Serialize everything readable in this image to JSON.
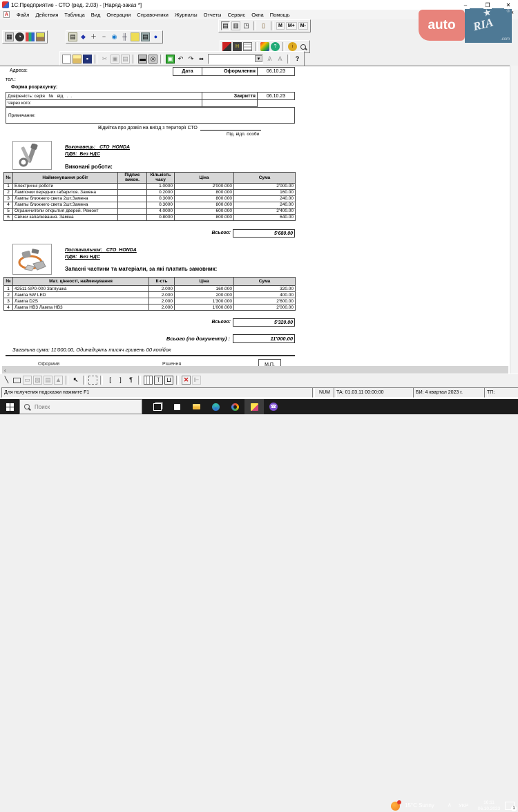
{
  "window": {
    "title": "1С:Предприятие - СТО (ред. 2.03) - [Наряд-заказ *]"
  },
  "icons": {
    "minimize": "–",
    "restore": "❐",
    "close": "✕",
    "mdi_close": "x",
    "menu_doc_letter": "А",
    "cut": "✂",
    "undo": "↶",
    "redo": "↷",
    "find": "∞",
    "help": "?",
    "dropdown": "▾",
    "scroll_up": "˄",
    "scroll_down": "˅",
    "scroll_left": "‹",
    "cursor": "↖",
    "paragraph": "¶",
    "bracket_open": "[",
    "bracket_close": "]",
    "line_tool": "╲",
    "red_cross": "✕",
    "chevron_up": "∧",
    "phone": "☎",
    "memory": [
      "М",
      "М+",
      "М-"
    ]
  },
  "menu": {
    "items": [
      "Файл",
      "Действия",
      "Таблица",
      "Вид",
      "Операции",
      "Справочники",
      "Журналы",
      "Отчеты",
      "Сервис",
      "Окна",
      "Помощь"
    ]
  },
  "watermark": {
    "auto": "auto",
    "ria": "RIA",
    "star": "★",
    "com": ".com",
    "reg": "®"
  },
  "doc": {
    "address_label": "Адреса:",
    "phone_label": "тел.:",
    "date_label": "Дата",
    "registration_label": "Оформлення",
    "registration_date": "06.10.23",
    "payment_form": "Форма розрахунку:",
    "proxy": "Довіреність: серія   №   від   .  .",
    "closing_label": "Закриття",
    "closing_date": "06.10.23",
    "via_label": "Через кого:",
    "note_label": "Примечание:",
    "exit_note": "Відмітка про дозвіл на виїзд з території СТО",
    "exit_officer": "Під. відп. особи",
    "executor": {
      "label": "Виконавець:   СТО  HONDA",
      "vat": "ПДВ:  Без НДС",
      "works_title": "Виконані роботи:"
    },
    "works_table": {
      "headers": [
        "№",
        "Найменування робіт",
        "Підпис викон.",
        "Кількість часу",
        "Ціна",
        "Сума"
      ],
      "rows": [
        [
          "1",
          "Електричні роботи",
          "",
          "1.0000",
          "2'000.000",
          "2'000.00"
        ],
        [
          "2",
          "Лампочки передних габаритов. Замена",
          "",
          "0.2000",
          "800.000",
          "160.00"
        ],
        [
          "3",
          "Лампы ближнего света 2шт.Замена",
          "",
          "0.3000",
          "800.000",
          "240.00"
        ],
        [
          "4",
          "Лампы ближнего света 2шт.Замена",
          "",
          "0.3000",
          "800.000",
          "240.00"
        ],
        [
          "5",
          "Ограничители открытия дверей. Ремонт",
          "",
          "4.0000",
          "600.000",
          "2'400.00"
        ],
        [
          "6",
          "Свічки запалювання. Заміна",
          "",
          "0.8000",
          "800.000",
          "640.00"
        ]
      ],
      "total_label": "Всього:",
      "total": "5'680.00"
    },
    "supplier": {
      "label": "Постачальник:   СТО  HONDA",
      "vat": "ПДВ:  Без НДС",
      "parts_title": "Запасні частини та матеріали, за які платить замовник:"
    },
    "parts_table": {
      "headers": [
        "№",
        "Мат. цінності, найменування",
        "К-сть",
        "Ціна",
        "Сума"
      ],
      "rows": [
        [
          "1",
          "42511-SP0-000 Заглушка",
          "2.000",
          "160.000",
          "320.00"
        ],
        [
          "2",
          "Лампа 5W LED",
          "2.000",
          "200.000",
          "400.00"
        ],
        [
          "3",
          "Лампа D2S",
          "2.000",
          "1'300.000",
          "2'600.00"
        ],
        [
          "4",
          "Лампа НВ3 Лампа НВ3",
          "2.000",
          "1'000.000",
          "2'000.00"
        ]
      ],
      "total_label": "Всього:",
      "total": "5'320.00"
    },
    "doc_total_label": "Всього (по документу) :",
    "doc_total": "11'000.00",
    "total_words": "Загальна сума:  11'000.00, Одинадцять тисяч гривень 00 копійок",
    "seal": "М.П.",
    "clipped_left": "Оформив",
    "clipped_mid": "Рішення"
  },
  "status": {
    "help": "Для получения подсказки нажмите F1",
    "num": "NUM",
    "ta": "ТА: 01.03.11  00:00:00",
    "bi": "БИ: 4 квартал 2023 г.",
    "tp": "ТП:"
  },
  "taskbar": {
    "search": "Поиск",
    "weather": "15°C Sunny",
    "lang": "УКР",
    "time": "16:11",
    "date": "06.10.2023",
    "badge": "1"
  }
}
